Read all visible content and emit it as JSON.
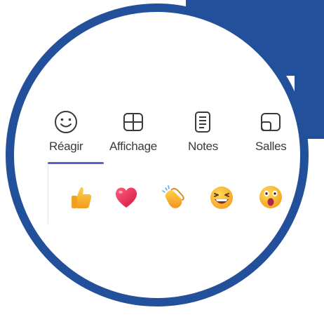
{
  "tabs": [
    {
      "id": "react",
      "label": "Réagir",
      "icon": "smiley-icon",
      "selected": true
    },
    {
      "id": "view",
      "label": "Affichage",
      "icon": "grid-layout-icon",
      "selected": false
    },
    {
      "id": "notes",
      "label": "Notes",
      "icon": "notes-document-icon",
      "selected": false
    },
    {
      "id": "rooms",
      "label": "Salles",
      "icon": "breakout-rooms-icon",
      "selected": false
    }
  ],
  "reactions": [
    {
      "name": "thumbs-up",
      "icon": "thumbs-up-icon"
    },
    {
      "name": "heart",
      "icon": "heart-icon"
    },
    {
      "name": "applause",
      "icon": "clapping-hands-icon"
    },
    {
      "name": "laugh",
      "icon": "laughing-face-icon"
    },
    {
      "name": "surprised",
      "icon": "surprised-face-icon"
    }
  ],
  "colors": {
    "frame": "#23509b",
    "accent": "#5b5fc7",
    "heart": "#e8345a",
    "emoji_yellow": "#f7b731"
  }
}
